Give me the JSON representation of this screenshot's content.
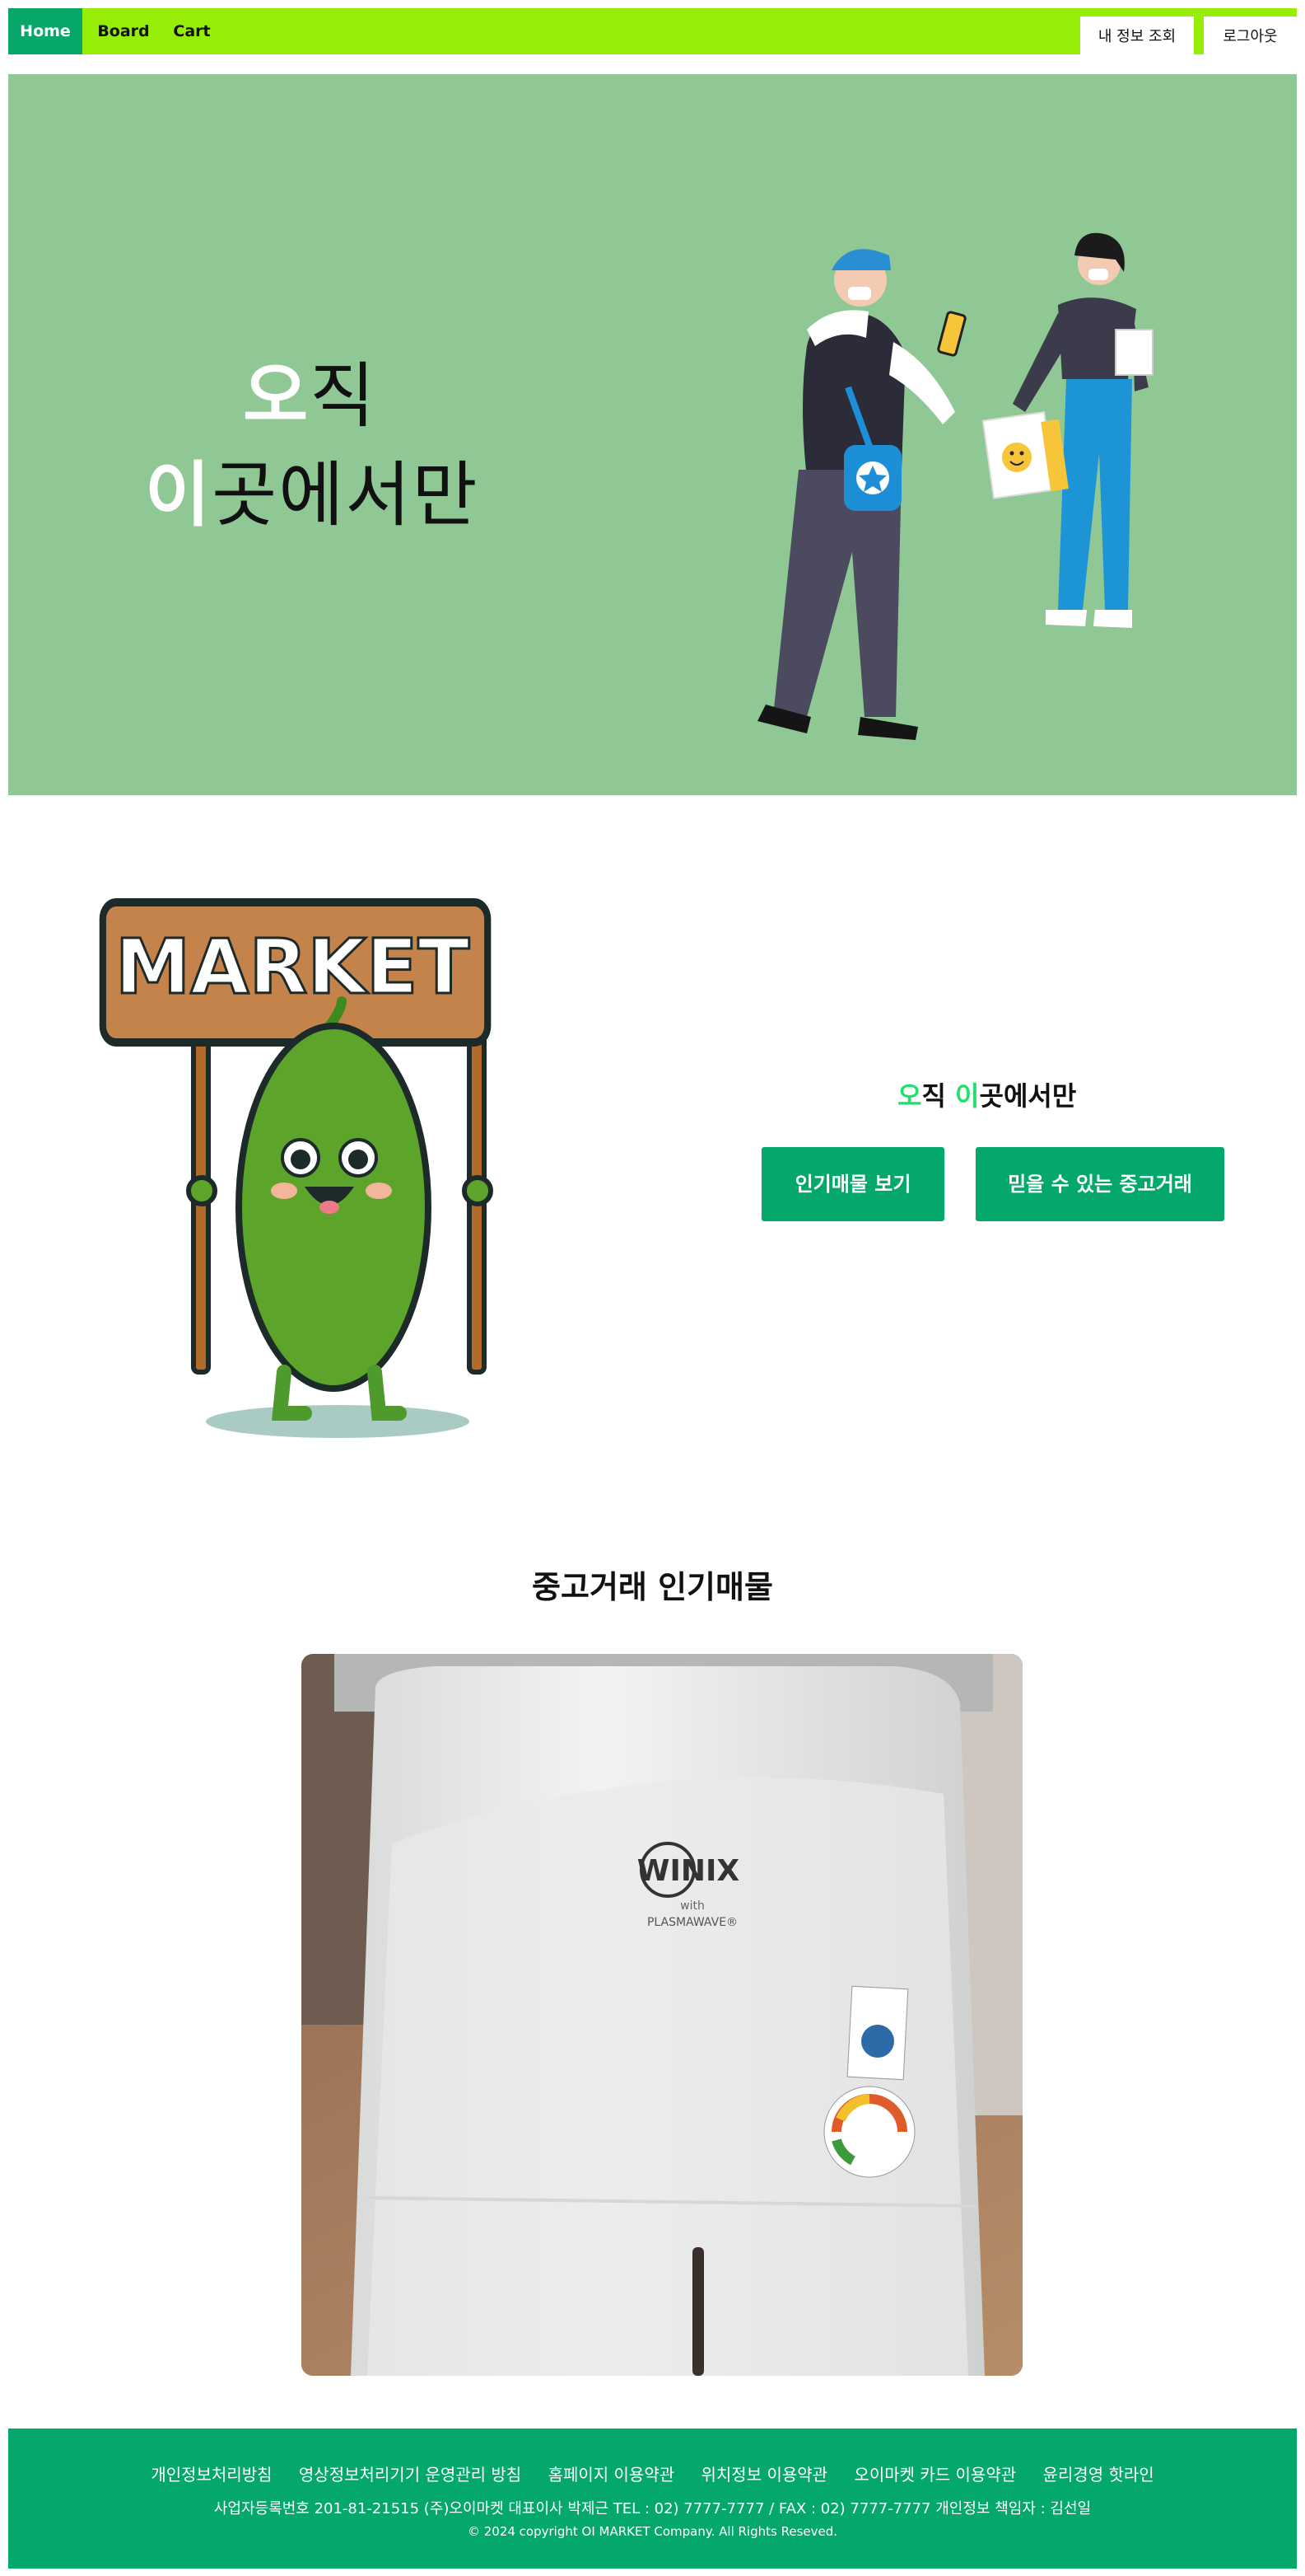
{
  "nav": {
    "home": "Home",
    "board": "Board",
    "cart": "Cart",
    "my_info": "내 정보 조회",
    "logout": "로그아웃"
  },
  "hero": {
    "line1_highlight": "오",
    "line1_rest": "직",
    "line2_highlight": "이",
    "line2_rest": "곳에서만"
  },
  "promo": {
    "title_h1": "오",
    "title_p1": "직 ",
    "title_h2": "이",
    "title_p2": "곳에서만",
    "btn_popular": "인기매물 보기",
    "btn_trust": "믿을 수 있는 중고거래",
    "mascot_sign": "MARKET"
  },
  "popular": {
    "title": "중고거래 인기매물",
    "product_brand": "WINIX",
    "product_sub1": "with",
    "product_sub2": "PLASMAWAVE®"
  },
  "footer": {
    "links": [
      "개인정보처리방침",
      "영상정보처리기기 운영관리 방침",
      "홈페이지 이용약관",
      "위치정보 이용약관",
      "오이마켓 카드 이용약관",
      "윤리경영 핫라인"
    ],
    "info": "사업자등록번호 201-81-21515 (주)오이마켓 대표이사 박제근 TEL : 02) 7777-7777 / FAX : 02) 7777-7777 개인정보 책임자 : 김선일",
    "copyright": "© 2024 copyright OI MARKET Company. All Rights Reseved."
  },
  "colors": {
    "nav_bg": "#96ee08",
    "accent_green": "#05a86b",
    "hero_bg": "#90c895",
    "highlight_green": "#1ee06a"
  }
}
